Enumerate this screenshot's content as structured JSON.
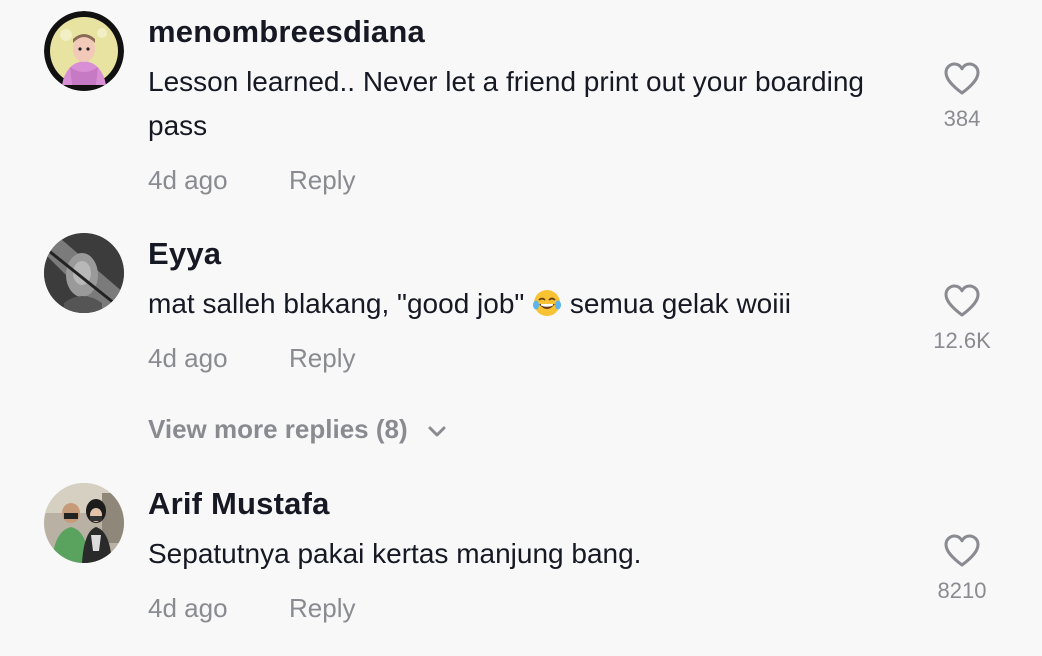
{
  "comments": [
    {
      "username": "menombreesdiana",
      "text": "Lesson learned.. Never let a friend print out your boarding pass",
      "time": "4d ago",
      "reply_label": "Reply",
      "likes": "384",
      "avatar_icon": "avatar-cartoon-pink-hoodie"
    },
    {
      "username": "Eyya",
      "text_before_emoji": "mat salleh blakang, \"good job\"",
      "emoji": "face-with-tears-of-joy",
      "text_after_emoji": "semua gelak woiii",
      "time": "4d ago",
      "reply_label": "Reply",
      "likes": "12.6K",
      "avatar_icon": "avatar-grayscale-photo"
    },
    {
      "username": "Arif Mustafa",
      "text": "Sepatutnya pakai kertas manjung bang.",
      "time": "4d ago",
      "reply_label": "Reply",
      "likes": "8210",
      "avatar_icon": "avatar-photo-two-people"
    }
  ],
  "view_more_replies": "View more replies (8)",
  "colors": {
    "background": "#f8f8f8",
    "username": "#161823",
    "secondary": "#8a8b91"
  }
}
